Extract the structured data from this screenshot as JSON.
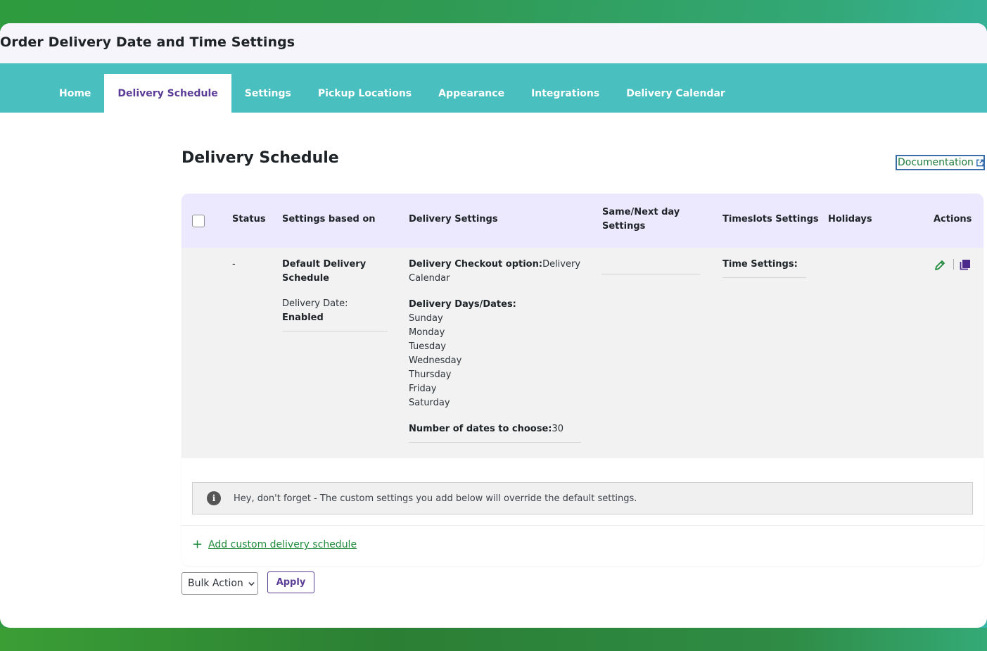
{
  "page_title": "Order Delivery Date and Time Settings",
  "tabs": [
    {
      "label": "Home"
    },
    {
      "label": "Delivery Schedule"
    },
    {
      "label": "Settings"
    },
    {
      "label": "Pickup Locations"
    },
    {
      "label": "Appearance"
    },
    {
      "label": "Integrations"
    },
    {
      "label": "Delivery Calendar"
    }
  ],
  "active_tab": "Delivery Schedule",
  "section_title": "Delivery Schedule",
  "documentation_label": "Documentation",
  "table": {
    "headers": {
      "status": "Status",
      "settings_based_on": "Settings based on",
      "delivery_settings": "Delivery Settings",
      "same_next_day_1": "Same/Next day",
      "same_next_day_2": "Settings",
      "timeslots": "Timeslots Settings",
      "holidays": "Holidays",
      "actions": "Actions"
    },
    "row": {
      "status": "-",
      "schedule_name_1": "Default Delivery",
      "schedule_name_2": "Schedule",
      "delivery_date_label": "Delivery Date: ",
      "delivery_date_value": "Enabled",
      "checkout_option_label": "Delivery Checkout option:",
      "checkout_option_value_1": "Delivery",
      "checkout_option_value_2": "Calendar",
      "days_label": "Delivery Days/Dates:",
      "days": [
        "Sunday",
        "Monday",
        "Tuesday",
        "Wednesday",
        "Thursday",
        "Friday",
        "Saturday"
      ],
      "num_dates_label": "Number of dates to choose:",
      "num_dates_value": "30",
      "time_settings_label": "Time Settings:"
    }
  },
  "notice_text": "Hey, don't forget - The custom settings you add below will override the default settings.",
  "add_custom_label": " Add custom delivery schedule",
  "bulk_action_label": "Bulk Action",
  "apply_label": "Apply",
  "colors": {
    "tab_bar": "#49bfbf",
    "active_tab_text": "#5b3c97",
    "header_row": "#ece8fd",
    "link_green": "#1f8a3b"
  }
}
